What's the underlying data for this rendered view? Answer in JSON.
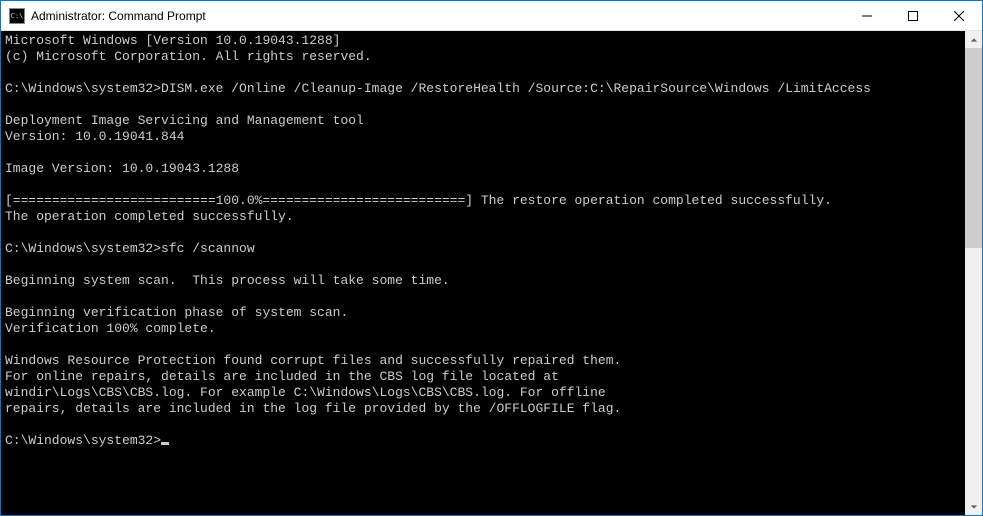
{
  "window": {
    "title": "Administrator: Command Prompt"
  },
  "terminal": {
    "lines": [
      "Microsoft Windows [Version 10.0.19043.1288]",
      "(c) Microsoft Corporation. All rights reserved.",
      "",
      "C:\\Windows\\system32>DISM.exe /Online /Cleanup-Image /RestoreHealth /Source:C:\\RepairSource\\Windows /LimitAccess",
      "",
      "Deployment Image Servicing and Management tool",
      "Version: 10.0.19041.844",
      "",
      "Image Version: 10.0.19043.1288",
      "",
      "[==========================100.0%==========================] The restore operation completed successfully.",
      "The operation completed successfully.",
      "",
      "C:\\Windows\\system32>sfc /scannow",
      "",
      "Beginning system scan.  This process will take some time.",
      "",
      "Beginning verification phase of system scan.",
      "Verification 100% complete.",
      "",
      "Windows Resource Protection found corrupt files and successfully repaired them.",
      "For online repairs, details are included in the CBS log file located at",
      "windir\\Logs\\CBS\\CBS.log. For example C:\\Windows\\Logs\\CBS\\CBS.log. For offline",
      "repairs, details are included in the log file provided by the /OFFLOGFILE flag.",
      ""
    ],
    "prompt": "C:\\Windows\\system32>"
  }
}
